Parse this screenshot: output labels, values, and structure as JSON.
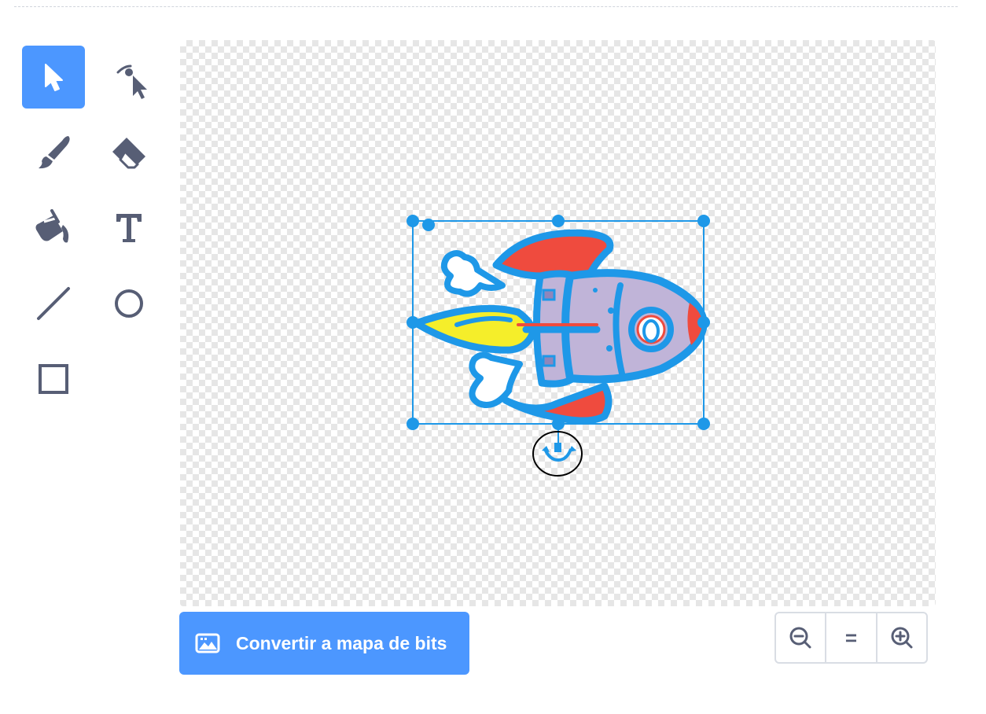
{
  "toolbar": {
    "tools": [
      {
        "id": "select",
        "icon": "select-arrow-icon",
        "selected": true
      },
      {
        "id": "reshape",
        "icon": "reshape-icon",
        "selected": false
      },
      {
        "id": "brush",
        "icon": "brush-icon",
        "selected": false
      },
      {
        "id": "eraser",
        "icon": "eraser-icon",
        "selected": false
      },
      {
        "id": "fill",
        "icon": "fill-bucket-icon",
        "selected": false
      },
      {
        "id": "text",
        "icon": "text-icon",
        "selected": false
      },
      {
        "id": "line",
        "icon": "line-icon",
        "selected": false
      },
      {
        "id": "circle",
        "icon": "circle-icon",
        "selected": false
      },
      {
        "id": "rectangle",
        "icon": "rectangle-icon",
        "selected": false
      }
    ],
    "selected_color": "#4c97ff",
    "icon_color": "#575e75"
  },
  "canvas": {
    "selection_color": "#1e98e8",
    "sprite": "rocket"
  },
  "convert_button": {
    "label": "Convertir a mapa de bits",
    "icon": "bitmap-image-icon"
  },
  "zoom_controls": {
    "zoom_out_icon": "zoom-out-icon",
    "reset_label": "=",
    "zoom_in_icon": "zoom-in-icon"
  },
  "colors": {
    "accent": "#4c97ff",
    "rocket_red": "#ef4b3e",
    "rocket_body": "#c0b4d8",
    "flame_yellow": "#f5ee2a",
    "outline_blue": "#1e98e8"
  }
}
